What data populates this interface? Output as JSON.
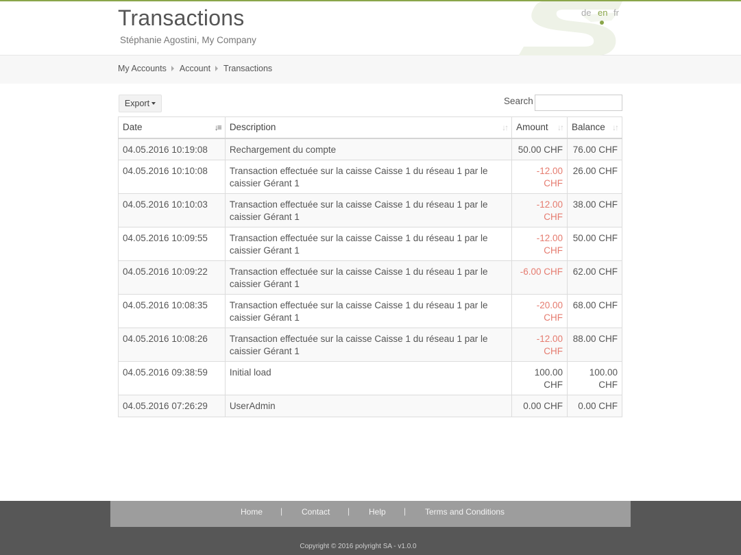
{
  "colors": {
    "accent": "#8aa64a",
    "negative": "#e57b6f",
    "footer_bg": "#575757",
    "footer_bar": "#9d9d9d"
  },
  "header": {
    "title": "Transactions",
    "subtitle": "Stéphanie Agostini, My Company",
    "languages": [
      "de",
      "en",
      "fr"
    ],
    "active_language": "en"
  },
  "breadcrumb": [
    "My Accounts",
    "Account",
    "Transactions"
  ],
  "toolbar": {
    "export_label": "Export",
    "search_label": "Search",
    "search_value": "",
    "search_placeholder": ""
  },
  "table": {
    "columns": [
      "Date",
      "Description",
      "Amount",
      "Balance"
    ],
    "rows": [
      {
        "date": "04.05.2016 10:19:08",
        "description": "Rechargement du compte",
        "amount": "50.00 CHF",
        "balance": "76.00 CHF"
      },
      {
        "date": "04.05.2016 10:10:08",
        "description": "Transaction effectuée sur la caisse Caisse 1 du réseau 1 par le caissier Gérant 1",
        "amount": "-12.00 CHF",
        "balance": "26.00 CHF"
      },
      {
        "date": "04.05.2016 10:10:03",
        "description": "Transaction effectuée sur la caisse Caisse 1 du réseau 1 par le caissier Gérant 1",
        "amount": "-12.00 CHF",
        "balance": "38.00 CHF"
      },
      {
        "date": "04.05.2016 10:09:55",
        "description": "Transaction effectuée sur la caisse Caisse 1 du réseau 1 par le caissier Gérant 1",
        "amount": "-12.00 CHF",
        "balance": "50.00 CHF"
      },
      {
        "date": "04.05.2016 10:09:22",
        "description": "Transaction effectuée sur la caisse Caisse 1 du réseau 1 par le caissier Gérant 1",
        "amount": "-6.00 CHF",
        "balance": "62.00 CHF"
      },
      {
        "date": "04.05.2016 10:08:35",
        "description": "Transaction effectuée sur la caisse Caisse 1 du réseau 1 par le caissier Gérant 1",
        "amount": "-20.00 CHF",
        "balance": "68.00 CHF"
      },
      {
        "date": "04.05.2016 10:08:26",
        "description": "Transaction effectuée sur la caisse Caisse 1 du réseau 1 par le caissier Gérant 1",
        "amount": "-12.00 CHF",
        "balance": "88.00 CHF"
      },
      {
        "date": "04.05.2016 09:38:59",
        "description": "Initial load",
        "amount": "100.00 CHF",
        "balance": "100.00 CHF"
      },
      {
        "date": "04.05.2016 07:26:29",
        "description": "UserAdmin",
        "amount": "0.00 CHF",
        "balance": "0.00 CHF"
      }
    ]
  },
  "footer": {
    "links": [
      "Home",
      "Contact",
      "Help",
      "Terms and Conditions"
    ],
    "separator": "|",
    "copyright": "Copyright © 2016 polyright SA   -   v1.0.0"
  }
}
